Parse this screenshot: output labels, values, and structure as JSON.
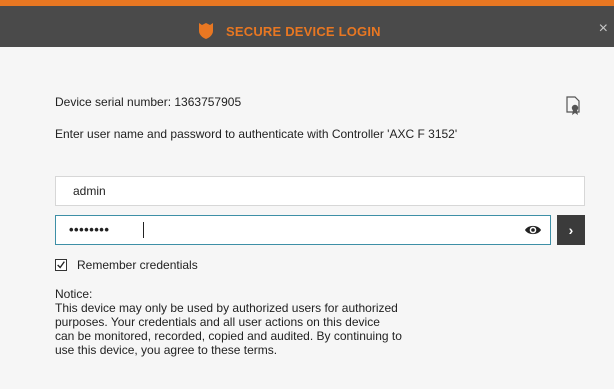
{
  "window": {
    "title": "SECURE DEVICE LOGIN",
    "close_symbol": "×",
    "accent_color": "#e87722",
    "titlebar_color": "#4a4a4a"
  },
  "device": {
    "serial_line": "Device serial number: 1363757905",
    "prompt": "Enter user name and password to authenticate with Controller 'AXC F 3152'"
  },
  "form": {
    "username_value": "admin",
    "password_mask": "••••••••",
    "submit_symbol": "›",
    "remember_label": "Remember credentials",
    "remember_checked": true
  },
  "notice": {
    "heading": "Notice:",
    "body": "This device may only be used by authorized users for authorized\npurposes. Your credentials and all user actions on this device\ncan be monitored, recorded, copied and audited. By continuing to\nuse this device, you agree to these terms."
  },
  "icons": {
    "title": "shield-icon",
    "certificate": "certificate-icon",
    "reveal": "eye-icon",
    "close": "close-icon",
    "check": "checkmark-icon"
  }
}
